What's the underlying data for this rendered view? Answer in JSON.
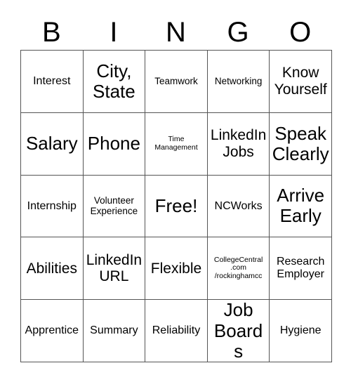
{
  "card": {
    "title_letters": [
      "B",
      "I",
      "N",
      "G",
      "O"
    ],
    "columns": 5,
    "rows": 5,
    "free_space_label": "Free!",
    "border_color": "#555555",
    "text_color": "#000000",
    "background_color": "#ffffff",
    "cells": [
      {
        "text": "Interest",
        "size": "md"
      },
      {
        "text": "City,\nState",
        "size": "xl"
      },
      {
        "text": "Teamwork",
        "size": "sm"
      },
      {
        "text": "Networking",
        "size": "sm"
      },
      {
        "text": "Know\nYourself",
        "size": "lg"
      },
      {
        "text": "Salary",
        "size": "xl"
      },
      {
        "text": "Phone",
        "size": "xl"
      },
      {
        "text": "Time\nManagement",
        "size": "xs"
      },
      {
        "text": "LinkedIn\nJobs",
        "size": "lg"
      },
      {
        "text": "Speak\nClearly",
        "size": "xl"
      },
      {
        "text": "Internship",
        "size": "md"
      },
      {
        "text": "Volunteer\nExperience",
        "size": "sm"
      },
      {
        "text": "Free!",
        "size": "xl"
      },
      {
        "text": "NCWorks",
        "size": "md"
      },
      {
        "text": "Arrive\nEarly",
        "size": "xl"
      },
      {
        "text": "Abilities",
        "size": "lg"
      },
      {
        "text": "LinkedIn\nURL",
        "size": "lg"
      },
      {
        "text": "Flexible",
        "size": "lg"
      },
      {
        "text": "CollegeCentral\n.com\n/rockinghamcc",
        "size": "xs"
      },
      {
        "text": "Research\nEmployer",
        "size": "md"
      },
      {
        "text": "Apprentice",
        "size": "md"
      },
      {
        "text": "Summary",
        "size": "md"
      },
      {
        "text": "Reliability",
        "size": "md"
      },
      {
        "text": "Job\nBoards",
        "size": "xl"
      },
      {
        "text": "Hygiene",
        "size": "md"
      }
    ]
  }
}
